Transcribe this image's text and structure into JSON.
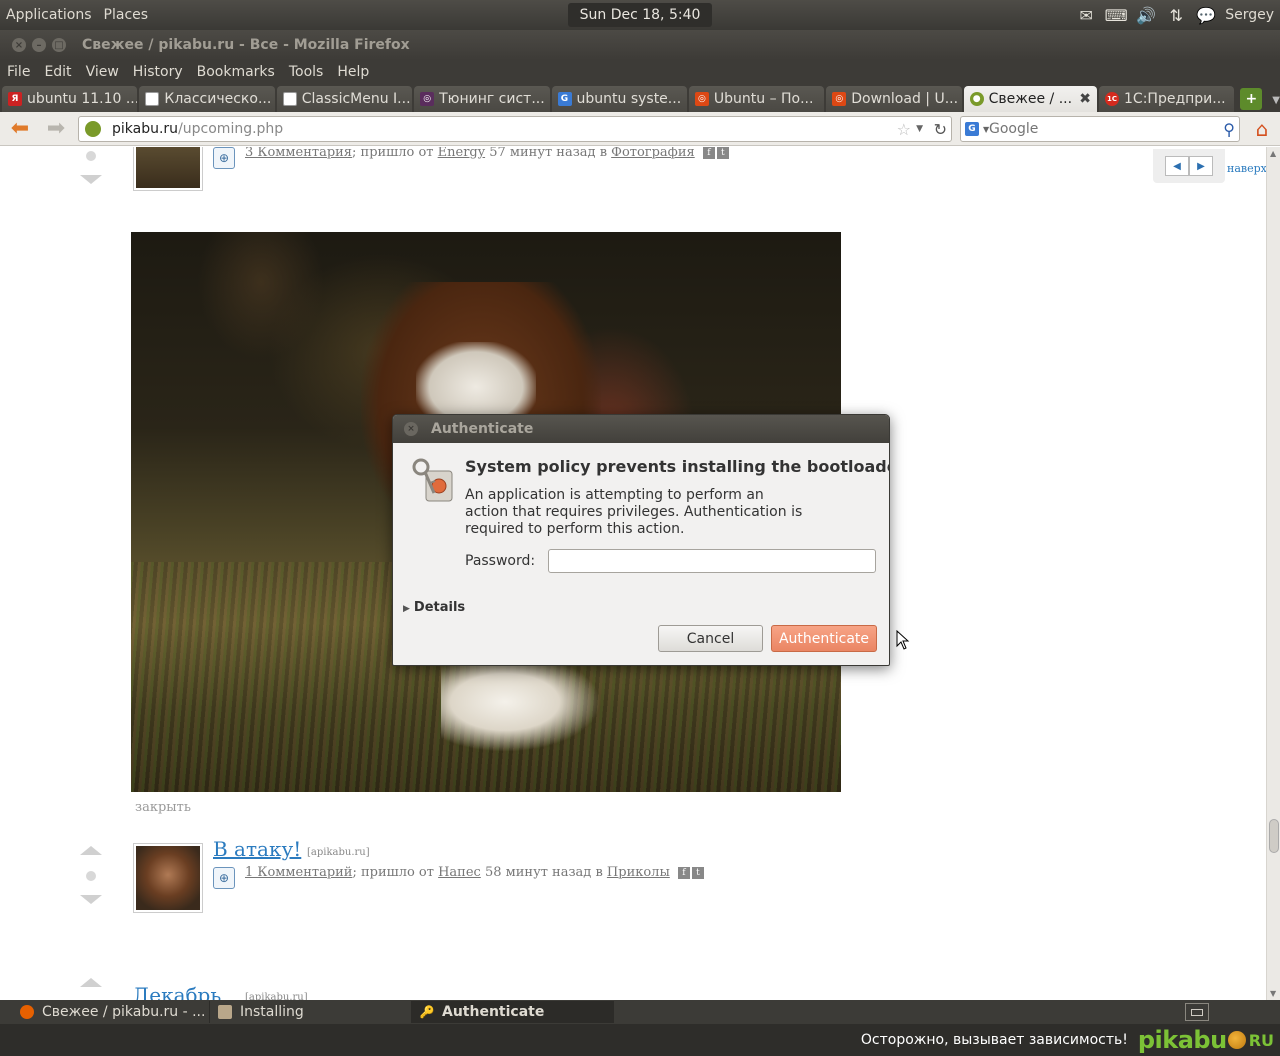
{
  "top_panel": {
    "applications": "Applications",
    "places": "Places",
    "clock": "Sun Dec 18,  5:40 PM",
    "user": "Sergey"
  },
  "window": {
    "title": "Свежее / pikabu.ru - Все - Mozilla Firefox"
  },
  "menubar": [
    "File",
    "Edit",
    "View",
    "History",
    "Bookmarks",
    "Tools",
    "Help"
  ],
  "tabs": [
    {
      "label": "ubuntu 11.10 ...",
      "fav_color": "#cc2222",
      "fav_char": "Я"
    },
    {
      "label": "Классическо...",
      "fav_color": "#ffffff",
      "fav_char": ""
    },
    {
      "label": "ClassicMenu I...",
      "fav_color": "#ffffff",
      "fav_char": ""
    },
    {
      "label": "Тюнинг сист...",
      "fav_color": "#5a2d5d",
      "fav_char": "◎"
    },
    {
      "label": "ubuntu syste...",
      "fav_color": "#3a7bd5",
      "fav_char": "G"
    },
    {
      "label": "Ubuntu – По...",
      "fav_color": "#dd4814",
      "fav_char": "◎"
    },
    {
      "label": "Download | U...",
      "fav_color": "#dd4814",
      "fav_char": "◎"
    },
    {
      "label": "Свежее / ...",
      "fav_color": "#7a9a2a",
      "fav_char": "●",
      "active": true
    },
    {
      "label": "1С:Предпри...",
      "fav_color": "#d42a1e",
      "fav_char": "1С"
    }
  ],
  "navbar": {
    "url_host": "pikabu.ru",
    "url_path": "/upcoming.php",
    "search_placeholder": "Google"
  },
  "page": {
    "post1_meta": {
      "comments": "3 Комментария",
      "from_text": "; пришло от ",
      "author": "Energy",
      "time_text": " 57 минут назад в ",
      "category": "Фотография"
    },
    "close_link": "закрыть",
    "post2": {
      "title": "В атаку!",
      "source": "[apikabu.ru]",
      "comments": "1 Комментарий",
      "from_text": "; пришло от ",
      "author": "Напес",
      "time_text": " 58 минут назад в ",
      "category": "Приколы"
    },
    "post3": {
      "title": "Декабрь",
      "source": "[apikabu.ru]"
    },
    "to_top": "наверх"
  },
  "dialog": {
    "title": "Authenticate",
    "heading": "System policy prevents installing the bootloader",
    "body": "An application is attempting to perform an action that requires privileges. Authentication is required to perform this action.",
    "password_label": "Password:",
    "details": "Details",
    "cancel": "Cancel",
    "authenticate": "Authenticate"
  },
  "taskbar": [
    {
      "label": "Свежее / pikabu.ru - ...",
      "icon": "firefox-icon"
    },
    {
      "label": "Installing",
      "icon": "installer-icon"
    },
    {
      "label": "Authenticate",
      "icon": "key-icon",
      "active": true
    }
  ],
  "watermark": {
    "text": "Осторожно, вызывает зависимость!",
    "logo": "pikabu",
    "logo_suffix": "RU"
  }
}
